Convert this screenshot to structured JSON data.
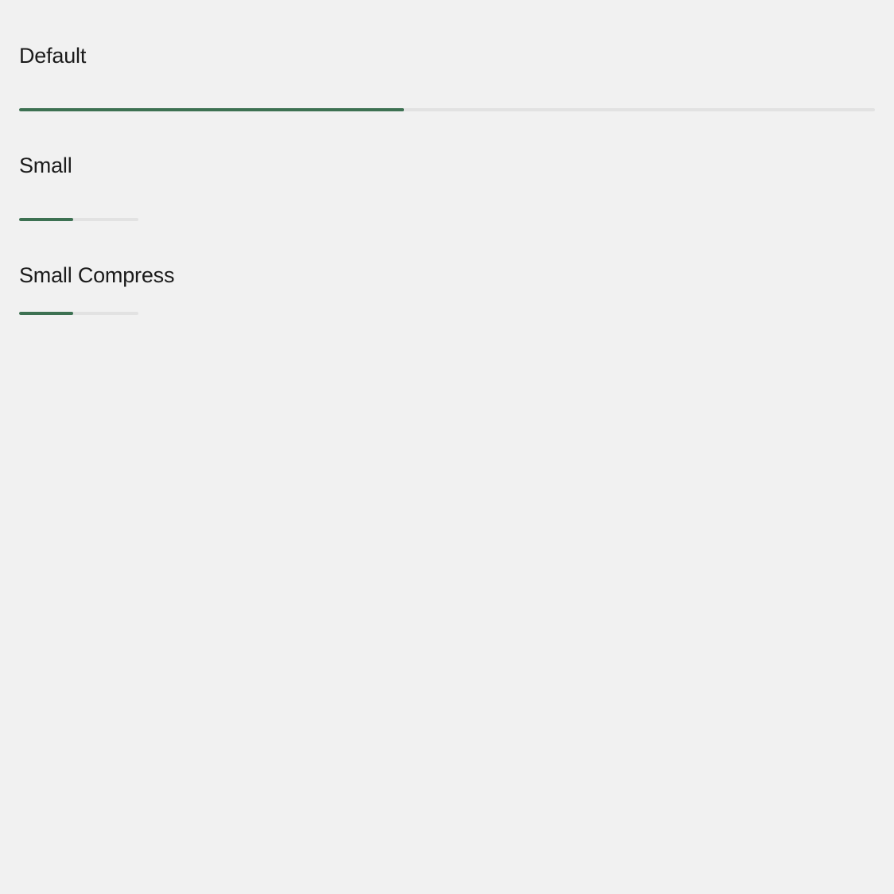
{
  "accent_color": "#3d7152",
  "track_color": "#e2e2e2",
  "background_color": "#f1f1f1",
  "progress_bars": [
    {
      "label": "Default",
      "progress": 0.45
    },
    {
      "label": "Small",
      "progress": 0.45
    },
    {
      "label": "Small Compress",
      "progress": 0.45
    }
  ]
}
